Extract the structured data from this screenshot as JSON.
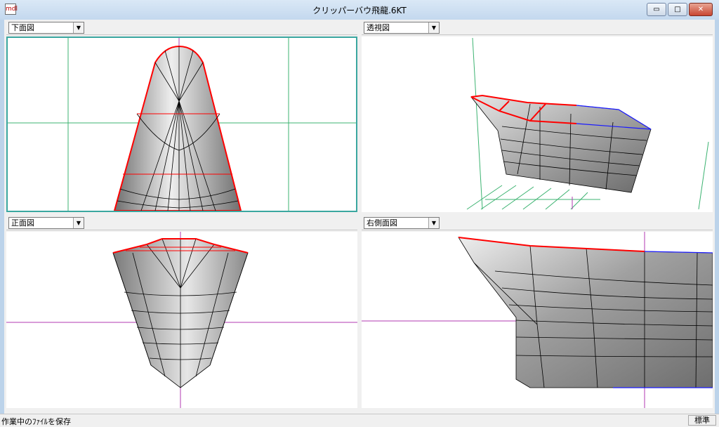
{
  "window": {
    "title": "クリッパーバウ飛龍.6KT",
    "app_icon": "mdl",
    "minimize_glyph": "▭",
    "maximize_glyph": "□",
    "close_glyph": "✕"
  },
  "panes": [
    {
      "view": "下面図",
      "active": true
    },
    {
      "view": "透視図",
      "active": false
    },
    {
      "view": "正面図",
      "active": false
    },
    {
      "view": "右側面図",
      "active": false
    }
  ],
  "dropdown_arrow": "▼",
  "status": {
    "message": "作業中のﾌｧｲﾙを保存",
    "mode": "標準"
  },
  "colors": {
    "selected_edge": "#ff0000",
    "grid": "#3cb371",
    "axis": "#b03ab0",
    "mesh_edge": "#000000",
    "blue_edge": "#1a1aff",
    "hull_light": "#e8e8e8",
    "hull_dark": "#7a7a7a"
  }
}
